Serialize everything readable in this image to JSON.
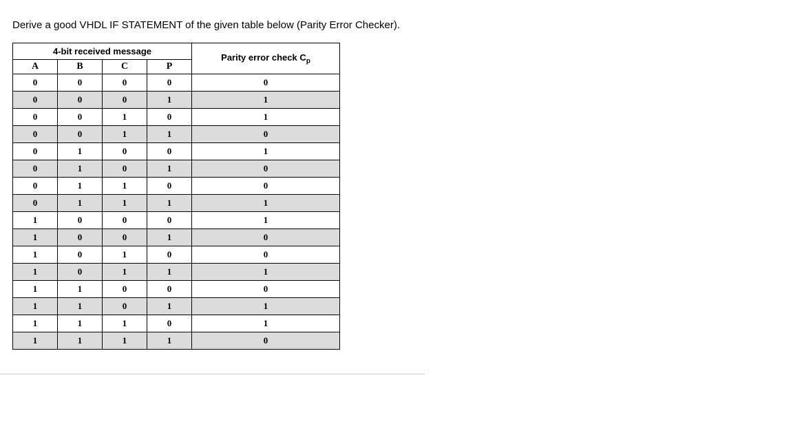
{
  "question": "Derive a good VHDL IF STATEMENT of the given table below (Parity Error Checker).",
  "headers": {
    "group": "4-bit received message",
    "colA": "A",
    "colB": "B",
    "colC": "C",
    "colP": "P",
    "parity_prefix": "Parity error check C",
    "parity_sub": "p"
  },
  "chart_data": {
    "type": "table",
    "columns": [
      "A",
      "B",
      "C",
      "P",
      "Cp"
    ],
    "rows": [
      {
        "A": "0",
        "B": "0",
        "C": "0",
        "P": "0",
        "Cp": "0"
      },
      {
        "A": "0",
        "B": "0",
        "C": "0",
        "P": "1",
        "Cp": "1"
      },
      {
        "A": "0",
        "B": "0",
        "C": "1",
        "P": "0",
        "Cp": "1"
      },
      {
        "A": "0",
        "B": "0",
        "C": "1",
        "P": "1",
        "Cp": "0"
      },
      {
        "A": "0",
        "B": "1",
        "C": "0",
        "P": "0",
        "Cp": "1"
      },
      {
        "A": "0",
        "B": "1",
        "C": "0",
        "P": "1",
        "Cp": "0"
      },
      {
        "A": "0",
        "B": "1",
        "C": "1",
        "P": "0",
        "Cp": "0"
      },
      {
        "A": "0",
        "B": "1",
        "C": "1",
        "P": "1",
        "Cp": "1"
      },
      {
        "A": "1",
        "B": "0",
        "C": "0",
        "P": "0",
        "Cp": "1"
      },
      {
        "A": "1",
        "B": "0",
        "C": "0",
        "P": "1",
        "Cp": "0"
      },
      {
        "A": "1",
        "B": "0",
        "C": "1",
        "P": "0",
        "Cp": "0"
      },
      {
        "A": "1",
        "B": "0",
        "C": "1",
        "P": "1",
        "Cp": "1"
      },
      {
        "A": "1",
        "B": "1",
        "C": "0",
        "P": "0",
        "Cp": "0"
      },
      {
        "A": "1",
        "B": "1",
        "C": "0",
        "P": "1",
        "Cp": "1"
      },
      {
        "A": "1",
        "B": "1",
        "C": "1",
        "P": "0",
        "Cp": "1"
      },
      {
        "A": "1",
        "B": "1",
        "C": "1",
        "P": "1",
        "Cp": "0"
      }
    ]
  }
}
